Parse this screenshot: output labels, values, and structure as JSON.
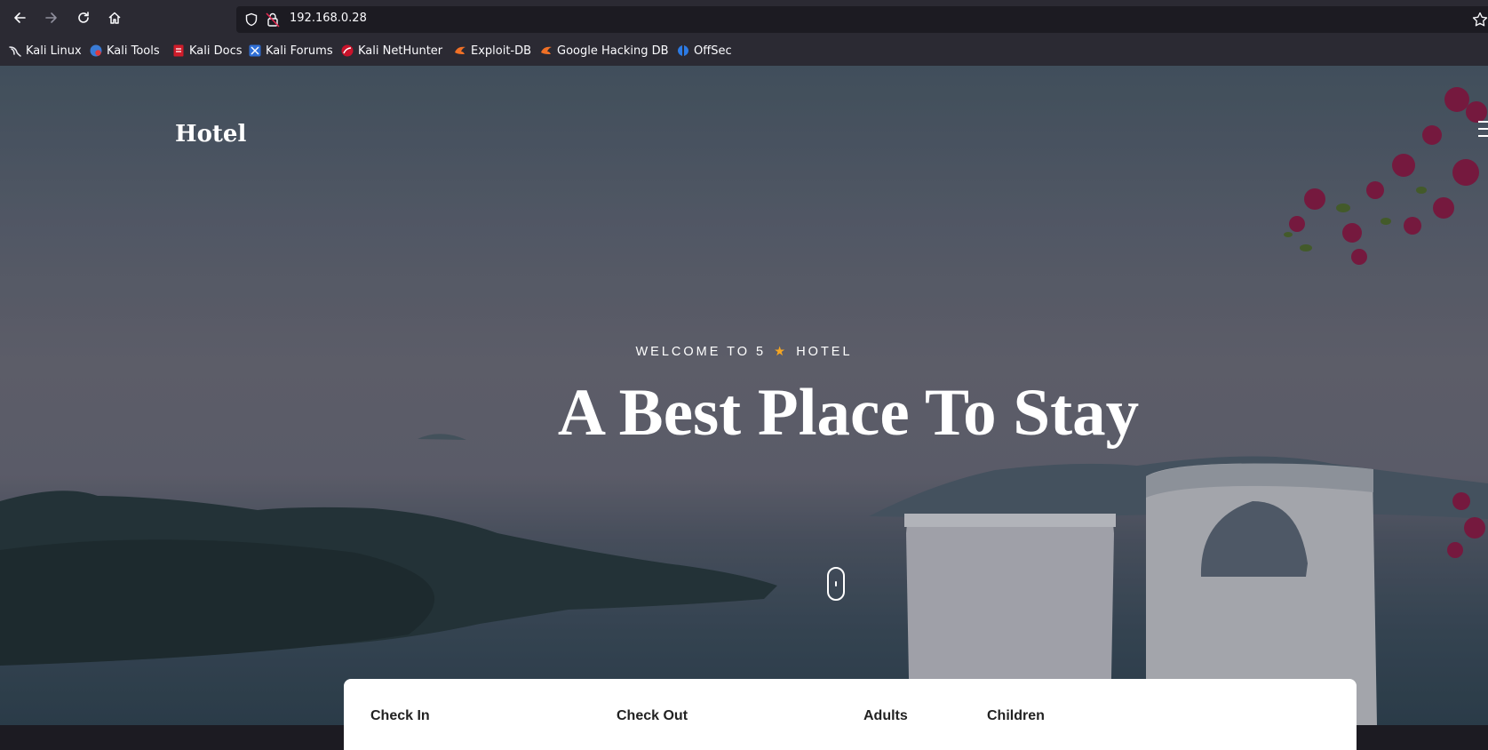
{
  "browser": {
    "url": "192.168.0.28",
    "bookmarks": [
      {
        "label": "Kali Linux",
        "icon": "kali-dragon-icon"
      },
      {
        "label": "Kali Tools",
        "icon": "kali-tools-icon"
      },
      {
        "label": "Kali Docs",
        "icon": "kali-docs-icon"
      },
      {
        "label": "Kali Forums",
        "icon": "kali-forums-icon"
      },
      {
        "label": "Kali NetHunter",
        "icon": "kali-nethunter-icon"
      },
      {
        "label": "Exploit-DB",
        "icon": "exploit-db-icon"
      },
      {
        "label": "Google Hacking DB",
        "icon": "ghdb-icon"
      },
      {
        "label": "OffSec",
        "icon": "offsec-icon"
      }
    ]
  },
  "page": {
    "brand": "Hotel",
    "welcome_pre": "WELCOME TO 5",
    "welcome_post": "HOTEL",
    "star": "★",
    "headline": "A Best Place To Stay",
    "booking_fields": [
      "Check In",
      "Check Out",
      "Adults",
      "Children"
    ]
  },
  "colors": {
    "accent_star": "#f5a623",
    "toolbar_bg": "#2b2a33",
    "urlbar_bg": "#1c1b22"
  }
}
